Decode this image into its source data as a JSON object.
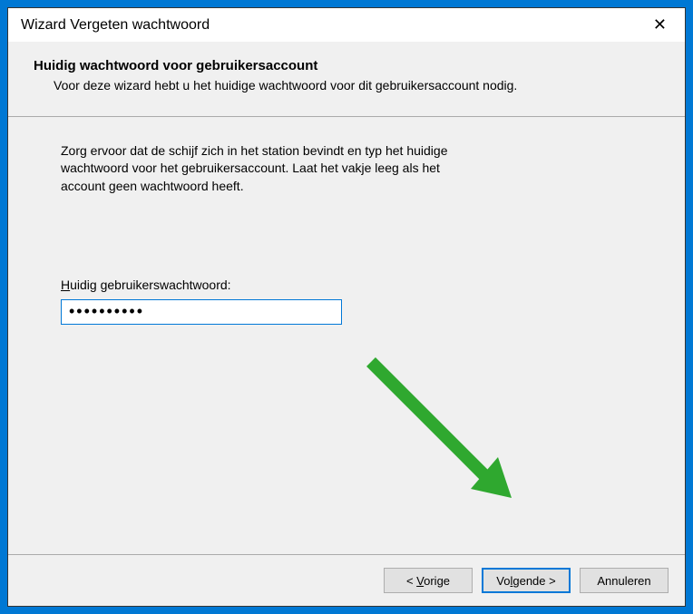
{
  "window": {
    "title": "Wizard Vergeten wachtwoord"
  },
  "header": {
    "title": "Huidig wachtwoord voor gebruikersaccount",
    "description": "Voor deze wizard hebt u het huidige wachtwoord voor dit gebruikersaccount nodig."
  },
  "content": {
    "instruction": "Zorg ervoor dat de schijf zich in het station bevindt en typ het huidige wachtwoord voor het gebruikersaccount. Laat het vakje leeg als het account geen wachtwoord heeft.",
    "password_label_prefix": "H",
    "password_label_rest": "uidig gebruikerswachtwoord:",
    "password_value": "••••••••••"
  },
  "buttons": {
    "back_prefix": "< ",
    "back_ul": "V",
    "back_rest": "orige",
    "next_prefix": "Vo",
    "next_ul": "l",
    "next_rest": "gende >",
    "cancel": "Annuleren"
  },
  "annotation": {
    "arrow_color": "#2fa82f"
  }
}
